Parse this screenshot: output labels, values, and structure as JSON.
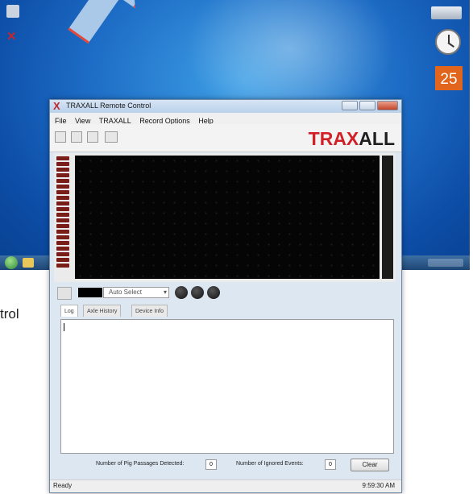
{
  "window": {
    "title": "TRAXALL Remote Control",
    "menu": [
      "File",
      "View",
      "TRAXALL",
      "Record Options",
      "Help"
    ],
    "brand": {
      "part1": "TRAX",
      "part2": "ALL",
      "color": "#d12028"
    }
  },
  "desktop": {
    "calendar_day": "25",
    "side_label": "trol"
  },
  "controls": {
    "color_select": "Auto Select"
  },
  "tabs": [
    "Log",
    "Axle History",
    "Device Info"
  ],
  "counters": {
    "pig_label": "Number of Pig Passages Detected:",
    "pig_value": "0",
    "ignored_label": "Number of Ignored Events:",
    "ignored_value": "0",
    "clear_label": "Clear"
  },
  "status": {
    "left": "Ready",
    "time": "9:59:30 AM"
  },
  "icons": [
    "recycle-bin-icon",
    "traxall-app-icon",
    "clock-gadget-icon",
    "play-icon",
    "stop-icon",
    "record-icon"
  ]
}
